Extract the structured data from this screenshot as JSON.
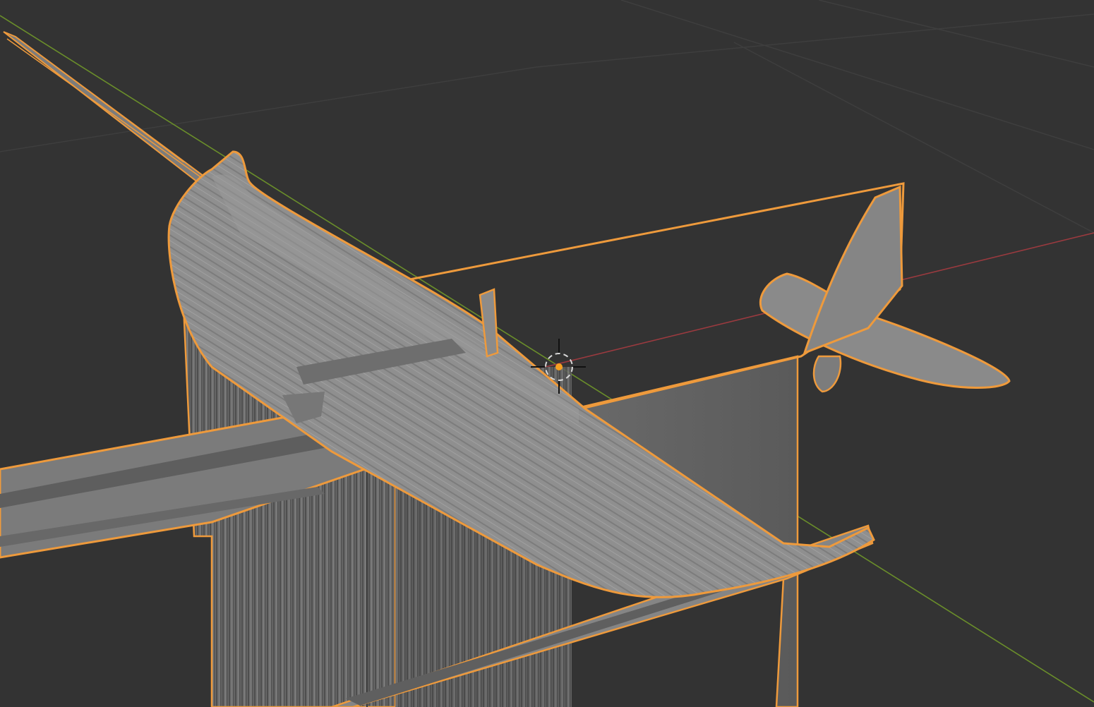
{
  "app": {
    "name": "3D Viewport",
    "view": "perspective"
  },
  "theme": {
    "background": "#333333",
    "grid": "#3e3e3e",
    "axis_x": "#9a3a3f",
    "axis_y": "#6a8e2a",
    "selection_outline": "#ee9a3c",
    "mesh_light": "#8e8e8e",
    "mesh_mid": "#7a7a7a",
    "mesh_dark": "#5c5c5c",
    "cursor_ring": "#d8d8d8",
    "cursor_center": "#f7a020"
  },
  "scene": {
    "objects": [
      {
        "name": "airplane-mesh",
        "selected": true,
        "kind": "mesh"
      }
    ],
    "cursor": {
      "label": "3d-cursor"
    }
  }
}
